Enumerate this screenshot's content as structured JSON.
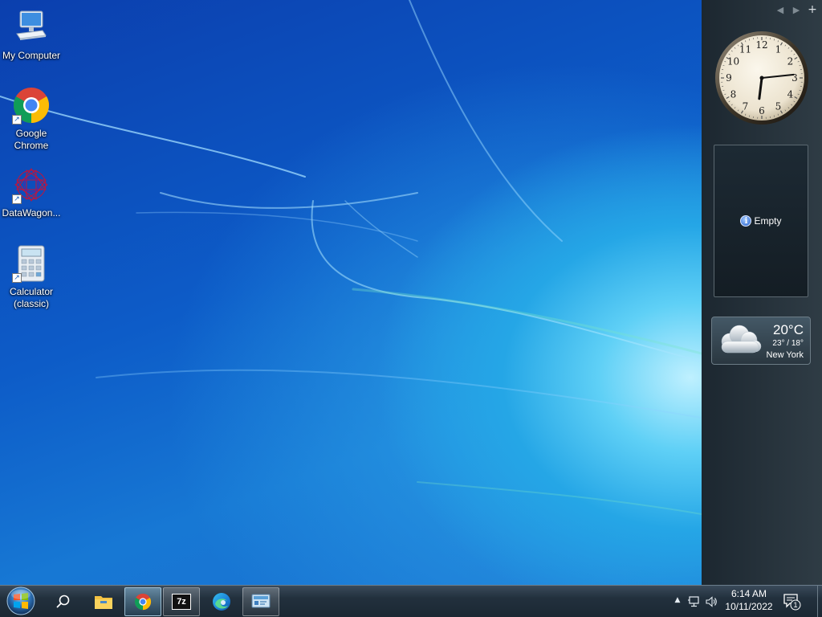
{
  "desktop": {
    "icons": [
      {
        "label": "My Computer",
        "icon": "computer-icon"
      },
      {
        "label": "Google Chrome",
        "icon": "chrome-icon"
      },
      {
        "label": "DataWagon...",
        "icon": "datawagon-icon"
      },
      {
        "label": "Calculator (classic)",
        "icon": "calculator-icon"
      }
    ]
  },
  "sidebar": {
    "controls": {
      "prev": "◀",
      "next": "▶",
      "add": "+"
    },
    "clock": {
      "numbers": [
        "12",
        "1",
        "2",
        "3",
        "4",
        "5",
        "6",
        "7",
        "8",
        "9",
        "10",
        "11"
      ],
      "hour": 6,
      "minute": 14
    },
    "slideshow": {
      "message": "Empty",
      "info_glyph": "i"
    },
    "weather": {
      "temperature": "20°C",
      "range": "23° / 18°",
      "city": "New York"
    }
  },
  "taskbar": {
    "start_icon": "windows-start-icon",
    "items": [
      {
        "name": "search",
        "icon": "search-icon"
      },
      {
        "name": "file-explorer",
        "icon": "folder-icon"
      },
      {
        "name": "chrome",
        "icon": "chrome-icon",
        "state": "active"
      },
      {
        "name": "7zip",
        "icon": "7zip-icon",
        "state": "running",
        "text": "7z"
      },
      {
        "name": "edge",
        "icon": "edge-icon"
      },
      {
        "name": "control-panel",
        "icon": "control-panel-icon",
        "state": "running"
      }
    ],
    "tray": {
      "overflow_glyph": "▲",
      "time": "6:14 AM",
      "date": "10/11/2022",
      "notification_count": "1"
    }
  },
  "colors": {
    "taskbar": "#22303d",
    "sidebar": "#2f3c45",
    "wallpaper": "#0d5cc8"
  }
}
